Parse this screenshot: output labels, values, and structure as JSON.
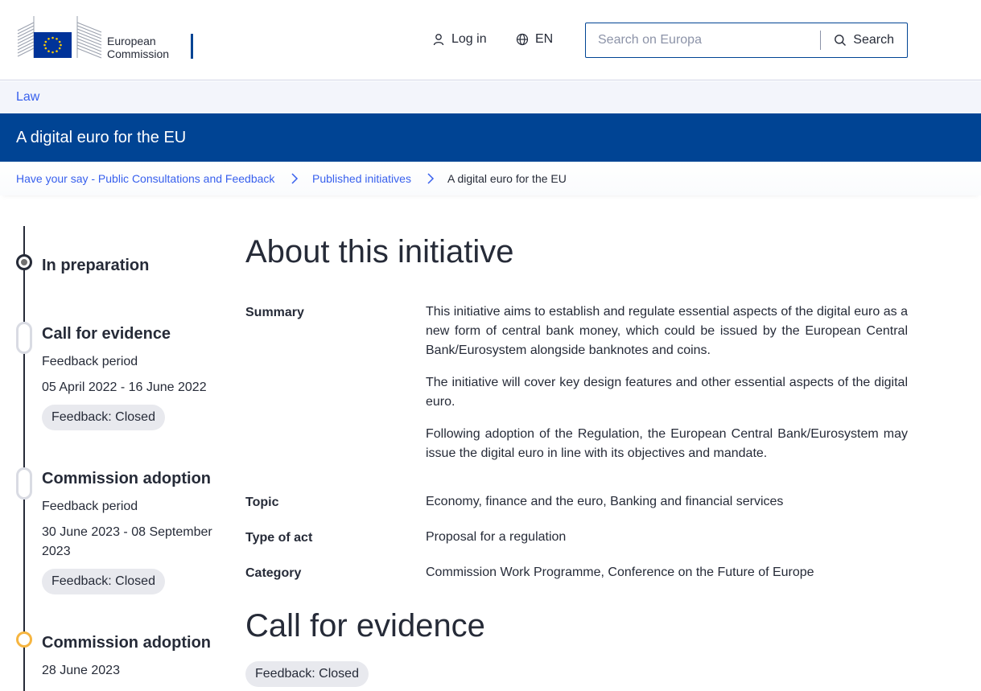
{
  "header": {
    "logo_line1": "European",
    "logo_line2": "Commission",
    "login_label": "Log in",
    "language_label": "EN",
    "search_placeholder": "Search on Europa",
    "search_button_label": "Search"
  },
  "site_nav": {
    "label": "Law"
  },
  "page_title": "A digital euro for the EU",
  "breadcrumb": [
    "Have your say - Public Consultations and Feedback",
    "Published initiatives",
    "A digital euro for the EU"
  ],
  "timeline": [
    {
      "title": "In preparation"
    },
    {
      "title": "Call for evidence",
      "period_label": "Feedback period",
      "dates": "05 April 2022 - 16 June 2022",
      "status": "Feedback: Closed"
    },
    {
      "title": "Commission adoption",
      "period_label": "Feedback period",
      "dates": "30 June 2023 - 08 September 2023",
      "status": "Feedback: Closed"
    },
    {
      "title": "Commission adoption",
      "date": "28 June 2023"
    }
  ],
  "about": {
    "heading": "About this initiative",
    "summary_label": "Summary",
    "summary_paragraphs": [
      "This initiative aims to establish and regulate essential aspects of the digital euro as a new form of central bank money, which could be issued by the European Central Bank/Eurosystem alongside banknotes and coins.",
      "The initiative will cover key design features and other essential aspects of the digital euro.",
      "Following adoption of the Regulation, the European Central Bank/Eurosystem may issue the digital euro in line with its objectives and mandate."
    ],
    "topic_label": "Topic",
    "topic_value": "Economy, finance and the euro, Banking and financial services",
    "type_label": "Type of act",
    "type_value": "Proposal for a regulation",
    "category_label": "Category",
    "category_value": "Commission Work Programme, Conference on the Future of Europe"
  },
  "call_for_evidence": {
    "heading": "Call for evidence",
    "status": "Feedback: Closed"
  },
  "colors": {
    "brand_blue": "#004494",
    "link_blue": "#3860ed",
    "eu_flag_blue": "#003399",
    "eu_star_yellow": "#FFCC00",
    "current_step": "#f6b540"
  }
}
